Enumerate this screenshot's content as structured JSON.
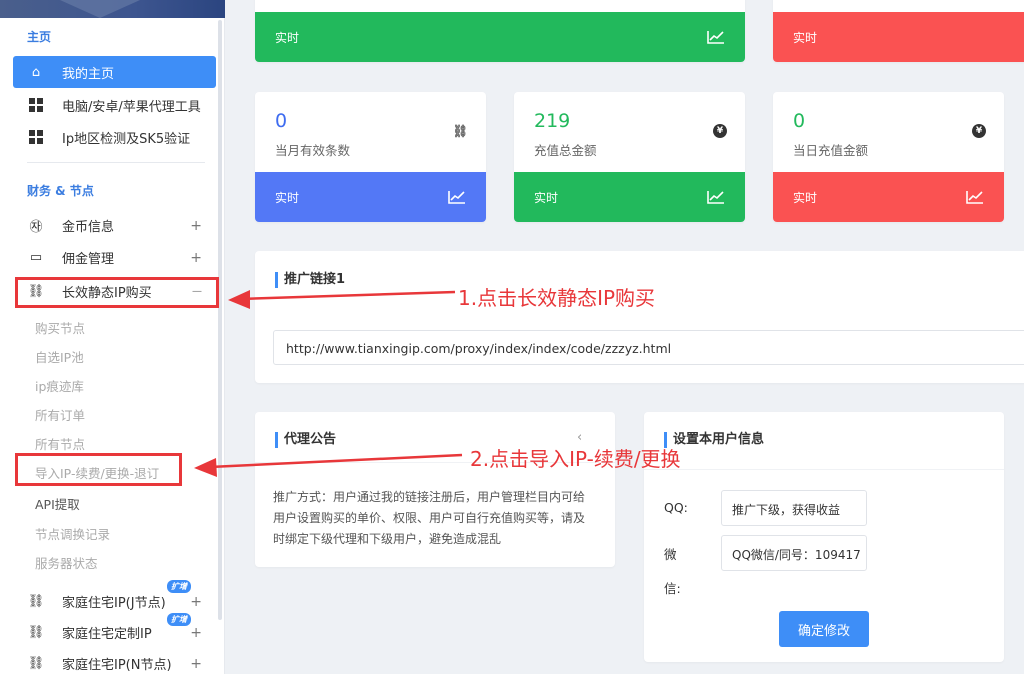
{
  "sidebar": {
    "section_home": "主页",
    "home_item": "我的主页",
    "tools_item": "电脑/安卓/苹果代理工具",
    "ipcheck_item": "Ip地区检测及SK5验证",
    "section_finance": "财务 & 节点",
    "coin_item": "金币信息",
    "commission_item": "佣金管理",
    "static_ip_item": "长效静态IP购买",
    "plus": "+",
    "minus": "—",
    "sub_items": [
      "购买节点",
      "自选IP池",
      "ip痕迹库",
      "所有订单",
      "所有节点",
      "导入IP-续费/更换-退订",
      "API提取",
      "节点调换记录",
      "服务器状态"
    ],
    "home_ip_j": "家庭住宅IP(J节点)",
    "home_custom": "家庭住宅定制IP",
    "home_ip_n": "家庭住宅IP(N节点)",
    "badge": "扩增"
  },
  "stats_top": [
    {
      "foot": "实时"
    },
    {
      "foot": "实时"
    }
  ],
  "stats": [
    {
      "value": "0",
      "label": "当月有效条数",
      "foot": "实时",
      "icon": "network-icon"
    },
    {
      "value": "219",
      "label": "充值总金额",
      "foot": "实时",
      "icon": "yen-icon"
    },
    {
      "value": "0",
      "label": "当日充值金额",
      "foot": "实时",
      "icon": "yen-icon"
    }
  ],
  "promo": {
    "title": "推广链接1",
    "url": "http://www.tianxingip.com/proxy/index/index/code/zzzyz.html"
  },
  "notice": {
    "title": "代理公告",
    "text": "推广方式：用户通过我的链接注册后，用户管理栏目内可给用户设置购买的单价、权限、用户可自行充值购买等，请及时绑定下级代理和下级用户，避免造成混乱"
  },
  "user_info": {
    "title": "设置本用户信息",
    "qq_label": "QQ:",
    "qq_value": "推广下级，获得收益",
    "wechat_label_1": "微",
    "wechat_label_2": "信:",
    "wechat_value": "QQ微信/同号：109417",
    "submit": "确定修改"
  },
  "annotations": {
    "step1": "1.点击长效静态IP购买",
    "step2": "2.点击导入IP-续费/更换"
  },
  "colors": {
    "accent": "#3e8ef7",
    "blue": "#5378f6",
    "green": "#22b95c",
    "red": "#fa5252",
    "annotation": "#e8373a"
  }
}
